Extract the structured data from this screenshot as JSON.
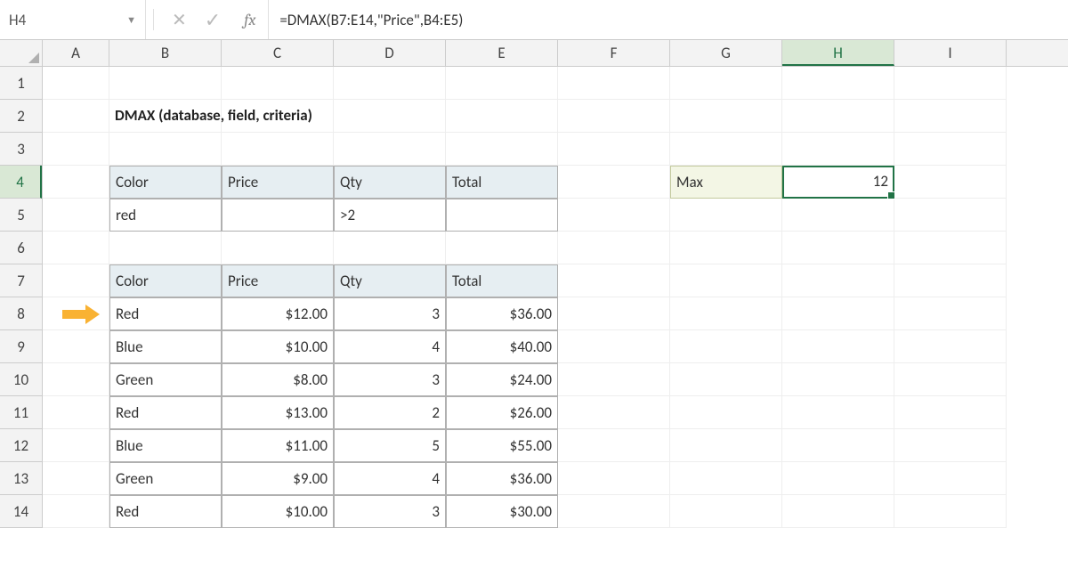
{
  "name_box": "H4",
  "formula": "=DMAX(B7:E14,\"Price\",B4:E5)",
  "fx_label": "fx",
  "columns": [
    "A",
    "B",
    "C",
    "D",
    "E",
    "F",
    "G",
    "H",
    "I"
  ],
  "rows": [
    "1",
    "2",
    "3",
    "4",
    "5",
    "6",
    "7",
    "8",
    "9",
    "10",
    "11",
    "12",
    "13",
    "14"
  ],
  "active_col": "H",
  "active_row": "4",
  "title": "DMAX (database, field, criteria)",
  "criteria_headers": [
    "Color",
    "Price",
    "Qty",
    "Total"
  ],
  "criteria_values": [
    "red",
    "",
    ">2",
    ""
  ],
  "db_headers": [
    "Color",
    "Price",
    "Qty",
    "Total"
  ],
  "db_rows": [
    {
      "color": "Red",
      "price": "$12.00",
      "qty": "3",
      "total": "$36.00",
      "pointer": true
    },
    {
      "color": "Blue",
      "price": "$10.00",
      "qty": "4",
      "total": "$40.00"
    },
    {
      "color": "Green",
      "price": "$8.00",
      "qty": "3",
      "total": "$24.00"
    },
    {
      "color": "Red",
      "price": "$13.00",
      "qty": "2",
      "total": "$26.00"
    },
    {
      "color": "Blue",
      "price": "$11.00",
      "qty": "5",
      "total": "$55.00"
    },
    {
      "color": "Green",
      "price": "$9.00",
      "qty": "4",
      "total": "$36.00"
    },
    {
      "color": "Red",
      "price": "$10.00",
      "qty": "3",
      "total": "$30.00"
    }
  ],
  "result": {
    "label": "Max",
    "value": "12"
  }
}
